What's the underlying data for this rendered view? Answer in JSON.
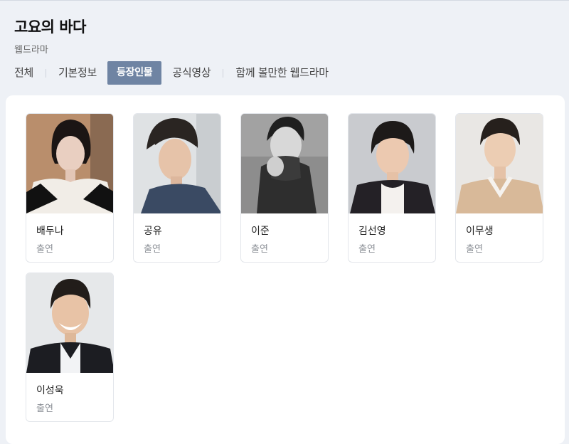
{
  "show": {
    "title": "고요의 바다",
    "category": "웹드라마"
  },
  "tabs": [
    {
      "label": "전체",
      "active": false
    },
    {
      "label": "기본정보",
      "active": false
    },
    {
      "label": "등장인물",
      "active": true
    },
    {
      "label": "공식영상",
      "active": false
    },
    {
      "label": "함께 볼만한 웹드라마",
      "active": false
    }
  ],
  "cast": [
    {
      "name": "배두나",
      "role": "출연"
    },
    {
      "name": "공유",
      "role": "출연"
    },
    {
      "name": "이준",
      "role": "출연"
    },
    {
      "name": "김선영",
      "role": "출연"
    },
    {
      "name": "이무생",
      "role": "출연"
    },
    {
      "name": "이성욱",
      "role": "출연"
    }
  ],
  "colors": {
    "active_tab_bg": "#6f84a3",
    "page_bg": "#eef1f6"
  }
}
